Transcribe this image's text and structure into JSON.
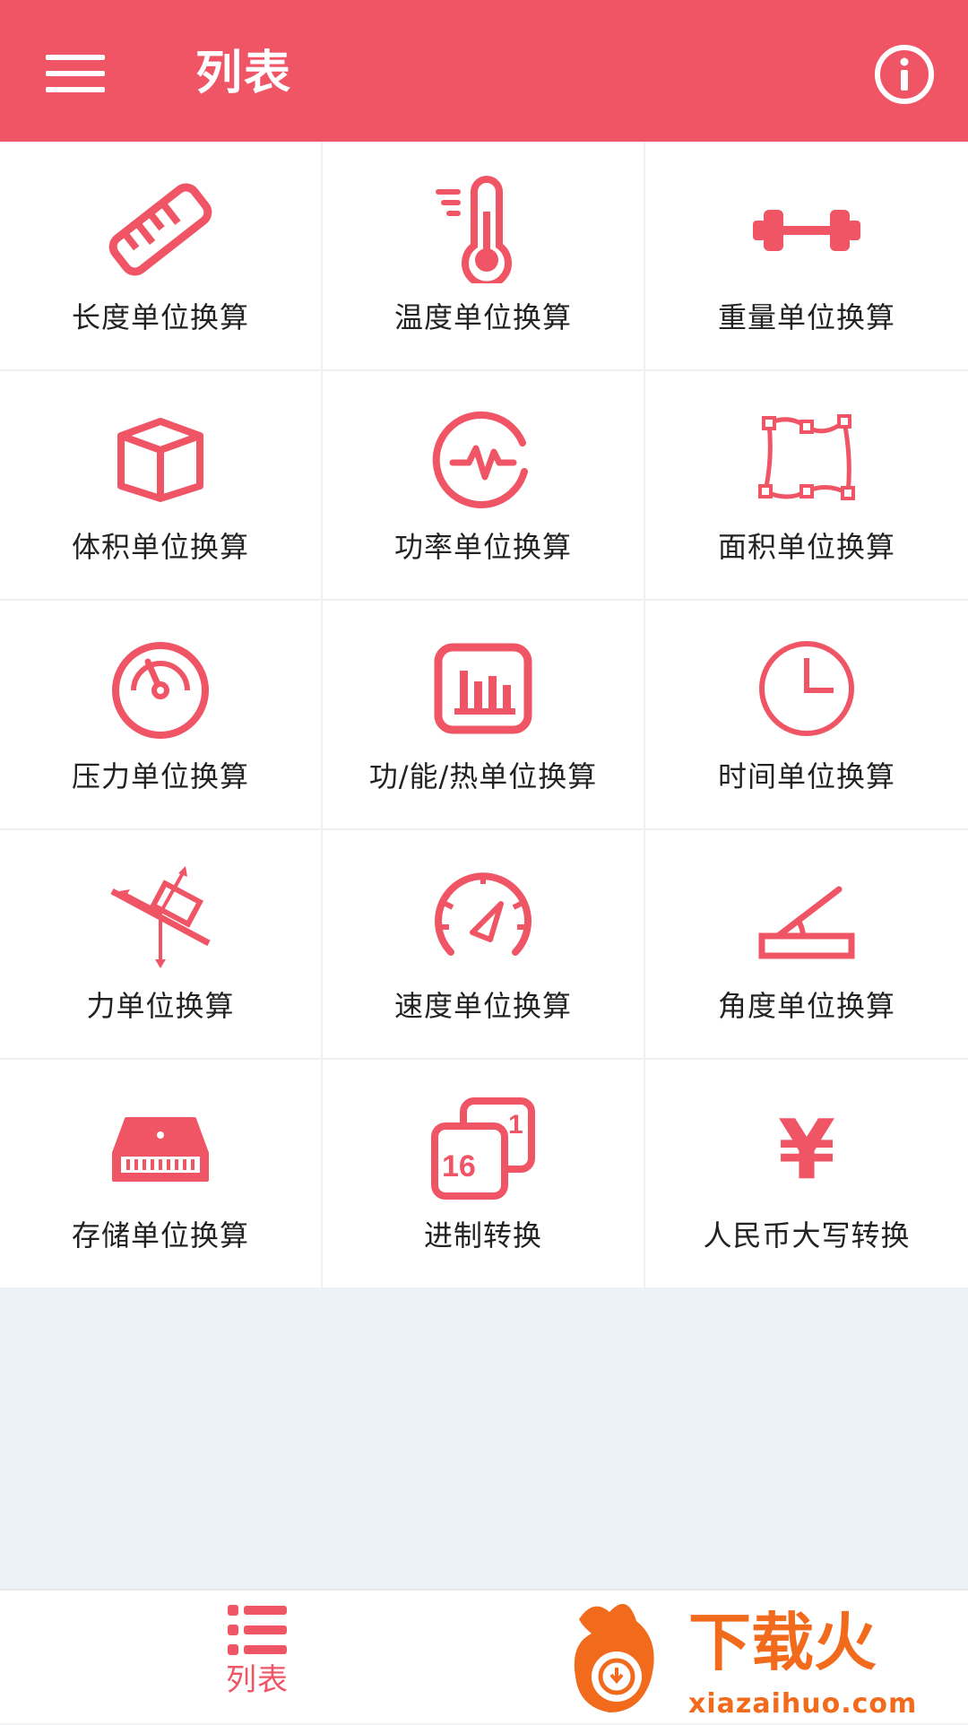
{
  "header": {
    "title": "列表",
    "menu_icon": "hamburger-menu-icon",
    "info_icon": "info-icon"
  },
  "colors": {
    "accent": "#f05566",
    "background": "#edf2f6",
    "cell_background": "#ffffff",
    "watermark_orange": "#f26a1b"
  },
  "converters": [
    {
      "label": "长度单位换算",
      "icon": "ruler-icon"
    },
    {
      "label": "温度单位换算",
      "icon": "thermometer-icon"
    },
    {
      "label": "重量单位换算",
      "icon": "dumbbell-icon"
    },
    {
      "label": "体积单位换算",
      "icon": "cube-icon"
    },
    {
      "label": "功率单位换算",
      "icon": "pulse-icon"
    },
    {
      "label": "面积单位换算",
      "icon": "area-polygon-icon"
    },
    {
      "label": "压力单位换算",
      "icon": "pressure-gauge-icon"
    },
    {
      "label": "功/能/热单位换算",
      "icon": "bar-chart-icon"
    },
    {
      "label": "时间单位换算",
      "icon": "clock-icon"
    },
    {
      "label": "力单位换算",
      "icon": "force-vector-icon"
    },
    {
      "label": "速度单位换算",
      "icon": "speedometer-icon"
    },
    {
      "label": "角度单位换算",
      "icon": "angle-icon"
    },
    {
      "label": "存储单位换算",
      "icon": "storage-drive-icon"
    },
    {
      "label": "进制转换",
      "icon": "number-base-icon"
    },
    {
      "label": "人民币大写转换",
      "icon": "yuan-icon"
    }
  ],
  "icon_text": {
    "base_16": "16",
    "base_1": "1",
    "yuan": "¥"
  },
  "bottom_nav": {
    "items": [
      {
        "label": "列表",
        "icon": "list-icon",
        "active": true
      }
    ]
  },
  "watermark": {
    "brand": "下载火",
    "domain": "xiazaihuo.com"
  }
}
